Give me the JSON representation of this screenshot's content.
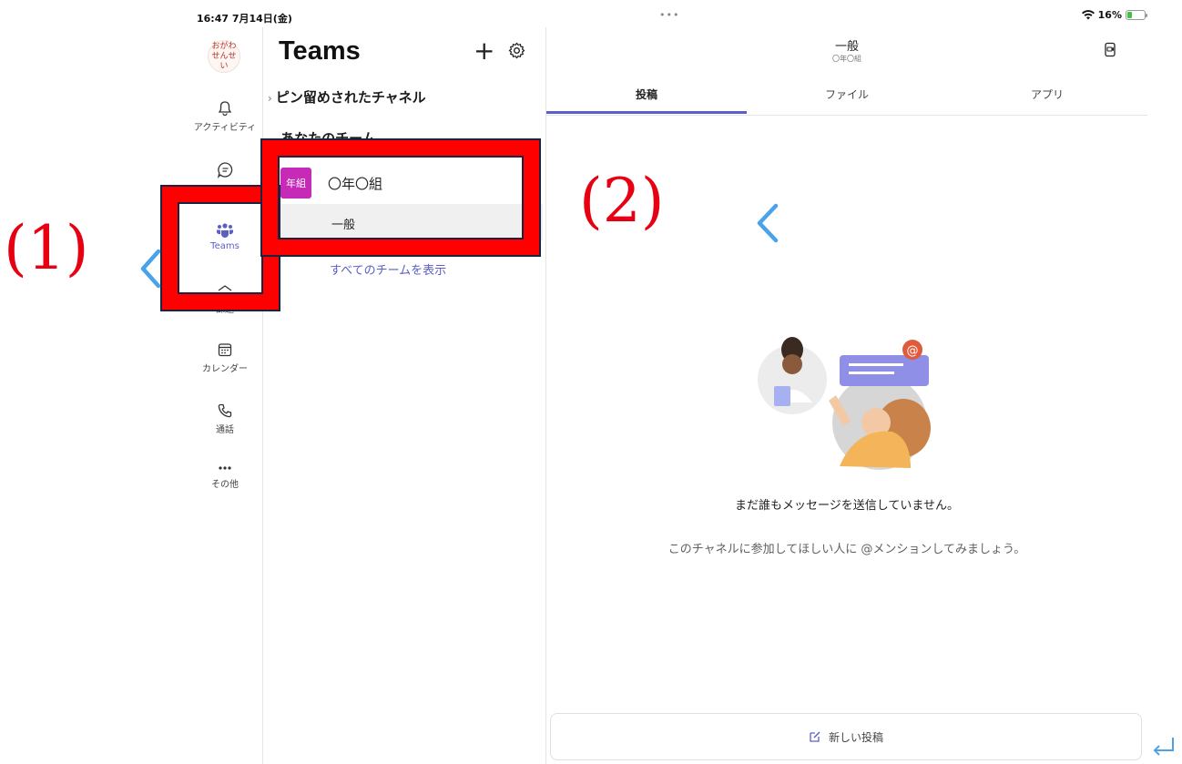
{
  "status_bar": {
    "time": "16:47  7月14日(金)",
    "dots": "•••",
    "battery": "16%"
  },
  "rail": {
    "avatar_text": "おがわ せんせい",
    "items": [
      {
        "label": "アクティビティ",
        "icon": "bell-icon"
      },
      {
        "label": "",
        "icon": "chat-icon"
      },
      {
        "label": "Teams",
        "icon": "teams-icon"
      },
      {
        "label": "課題",
        "icon": "assignments-icon"
      },
      {
        "label": "カレンダー",
        "icon": "calendar-icon"
      },
      {
        "label": "通話",
        "icon": "phone-icon"
      },
      {
        "label": "その他",
        "icon": "more-icon"
      }
    ]
  },
  "teams_list": {
    "title": "Teams",
    "pinned_section": "ピン留めされたチャネル",
    "your_teams_section": "あなたのチーム",
    "team": {
      "badge": "年組",
      "name": "〇年〇組"
    },
    "channel": "一般",
    "show_all": "すべてのチームを表示"
  },
  "channel": {
    "title": "一般",
    "subtitle": "〇年〇組",
    "tabs": [
      "投稿",
      "ファイル",
      "アプリ"
    ],
    "active_tab": "投稿",
    "empty_message": "まだ誰もメッセージを送信していません。",
    "empty_hint": "このチャネルに参加してほしい人に @メンションしてみましょう。",
    "new_post": "新しい投稿"
  },
  "annotations": {
    "label_1": "(1)",
    "label_2": "(2)",
    "highlight_color": "#ff0000",
    "arrow_color": "#4aa3e8"
  },
  "colors": {
    "accent": "#5b5fc7",
    "team_badge": "#c62bb8"
  }
}
